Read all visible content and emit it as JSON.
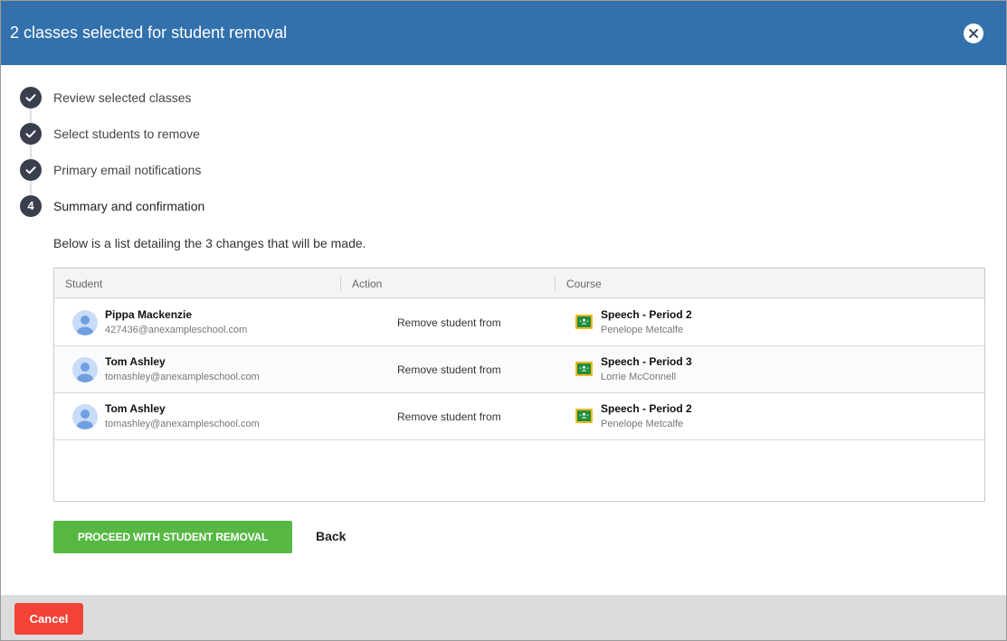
{
  "header": {
    "title": "2 classes selected for student removal",
    "close_icon": "close-icon"
  },
  "steps": [
    {
      "label": "Review selected classes",
      "state": "complete",
      "icon": "check-icon"
    },
    {
      "label": "Select students to remove",
      "state": "complete",
      "icon": "check-icon"
    },
    {
      "label": "Primary email notifications",
      "state": "complete",
      "icon": "check-icon"
    },
    {
      "label": "Summary and confirmation",
      "state": "active",
      "number": "4"
    }
  ],
  "intro_text": "Below is a list detailing the 3 changes that will be made.",
  "table": {
    "headers": {
      "student": "Student",
      "action": "Action",
      "course": "Course"
    },
    "rows": [
      {
        "student_name": "Pippa Mackenzie",
        "student_email": "427436@anexampleschool.com",
        "action": "Remove student from",
        "course_name": "Speech - Period 2",
        "teacher": "Penelope Metcalfe"
      },
      {
        "student_name": "Tom Ashley",
        "student_email": "tomashley@anexampleschool.com",
        "action": "Remove student from",
        "course_name": "Speech - Period 3",
        "teacher": "Lorrie McConnell"
      },
      {
        "student_name": "Tom Ashley",
        "student_email": "tomashley@anexampleschool.com",
        "action": "Remove student from",
        "course_name": "Speech - Period 2",
        "teacher": "Penelope Metcalfe"
      }
    ]
  },
  "buttons": {
    "proceed": "PROCEED WITH STUDENT REMOVAL",
    "back": "Back",
    "cancel": "Cancel"
  },
  "colors": {
    "header_bg": "#3371ad",
    "step_circle": "#3a3f4d",
    "proceed_bg": "#56b842",
    "cancel_bg": "#f34336",
    "footer_bg": "#dcdcdc",
    "classroom_icon_green": "#1e8e3e",
    "classroom_icon_yellow": "#f9b822"
  }
}
